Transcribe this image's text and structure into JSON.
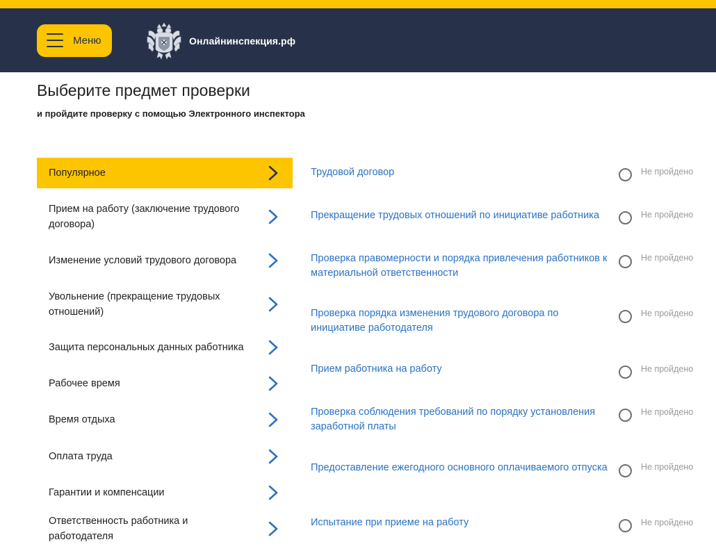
{
  "header": {
    "menu_label": "Меню",
    "site_name": "Онлайнинспекция.рф",
    "accent": "#fdc500",
    "bg": "#27324a"
  },
  "page": {
    "title": "Выберите предмет проверки",
    "subtitle": "и пройдите проверку с помощью Электронного инспектора"
  },
  "categories": [
    {
      "label": "Популярное",
      "active": true
    },
    {
      "label": "Прием на работу (заключение трудового договора)"
    },
    {
      "label": "Изменение условий трудового договора"
    },
    {
      "label": "Увольнение (прекращение трудовых отношений)"
    },
    {
      "label": "Защита персональных данных работника"
    },
    {
      "label": "Рабочее время"
    },
    {
      "label": "Время отдыха"
    },
    {
      "label": "Оплата труда"
    },
    {
      "label": "Гарантии и компенсации"
    },
    {
      "label": "Ответственность работника и работодателя"
    }
  ],
  "tests": [
    {
      "title": "Трудовой договор",
      "status": "Не пройдено"
    },
    {
      "title": "Прекращение трудовых отношений по инициативе работника",
      "status": "Не пройдено"
    },
    {
      "title": "Проверка правомерности и порядка привлечения работников к материальной ответственности",
      "status": "Не пройдено"
    },
    {
      "title": "Проверка порядка изменения трудового договора по инициативе работодателя",
      "status": "Не пройдено"
    },
    {
      "title": "Прием работника на работу",
      "status": "Не пройдено"
    },
    {
      "title": "Проверка соблюдения требований по порядку установления заработной платы",
      "status": "Не пройдено"
    },
    {
      "title": "Предоставление ежегодного основного оплачиваемого отпуска",
      "status": "Не пройдено"
    },
    {
      "title": "Испытание при приеме на работу",
      "status": "Не пройдено"
    }
  ],
  "icons": {
    "menu": "hamburger-icon",
    "emblem": "coat-of-arms-icon",
    "chevron": "chevron-right-icon",
    "radio": "radio-unchecked-icon"
  }
}
